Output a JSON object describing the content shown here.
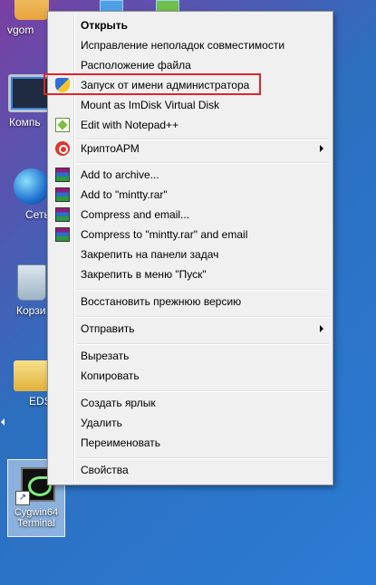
{
  "desktop": {
    "icons": [
      {
        "label": "vgom"
      },
      {
        "label": "Компь"
      },
      {
        "label": "Сеть"
      },
      {
        "label": "Корзи"
      },
      {
        "label": "EDS"
      }
    ],
    "cygwin": {
      "label_line1": "Cygwin64",
      "label_line2": "Terminal"
    }
  },
  "menu": {
    "items": [
      {
        "label": "Открыть",
        "bold": true
      },
      {
        "label": "Исправление неполадок совместимости"
      },
      {
        "label": "Расположение файла"
      },
      {
        "label": "Запуск от имени администратора",
        "icon": "uac-shield-icon"
      },
      {
        "label": "Mount as ImDisk Virtual Disk"
      },
      {
        "label": "Edit with Notepad++",
        "icon": "notepad-plus-plus-icon"
      },
      {
        "label": "КриптоАРМ",
        "icon": "cryptoarm-icon",
        "submenu": true
      },
      {
        "label": "Add to archive...",
        "icon": "winrar-icon"
      },
      {
        "label": "Add to \"mintty.rar\"",
        "icon": "winrar-icon"
      },
      {
        "label": "Compress and email...",
        "icon": "winrar-icon"
      },
      {
        "label": "Compress to \"mintty.rar\" and email",
        "icon": "winrar-icon"
      },
      {
        "label": "Закрепить на панели задач"
      },
      {
        "label": "Закрепить в меню \"Пуск\""
      },
      {
        "label": "Восстановить прежнюю версию"
      },
      {
        "label": "Отправить",
        "submenu": true
      },
      {
        "label": "Вырезать"
      },
      {
        "label": "Копировать"
      },
      {
        "label": "Создать ярлык"
      },
      {
        "label": "Удалить"
      },
      {
        "label": "Переименовать"
      },
      {
        "label": "Свойства"
      }
    ]
  },
  "colors": {
    "highlight_border": "#e2232a",
    "menu_bg": "#f0f0f0"
  }
}
